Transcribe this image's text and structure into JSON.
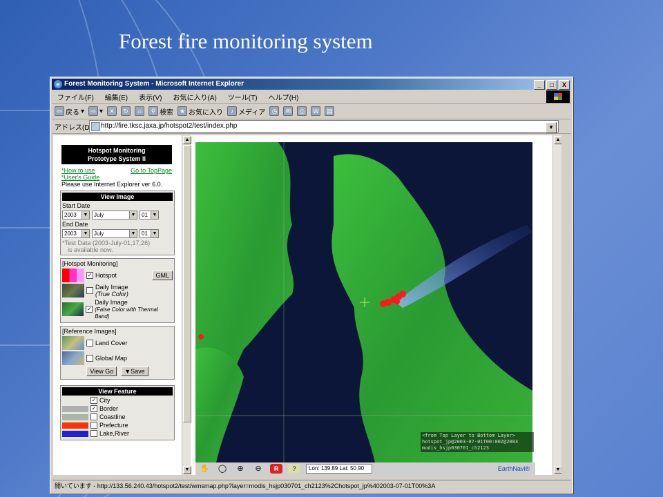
{
  "slide": {
    "title": "Forest fire monitoring system"
  },
  "window": {
    "title": "Forest Monitoring System - Microsoft Internet Explorer",
    "controls": [
      "_",
      "□",
      "X"
    ]
  },
  "menu": [
    "ファイル(F)",
    "編集(E)",
    "表示(V)",
    "お気に入り(A)",
    "ツール(T)",
    "ヘルプ(H)"
  ],
  "toolbar": {
    "back": "戻る",
    "search": "検索",
    "favorites": "お気に入り",
    "media": "メディア"
  },
  "address": {
    "label": "アドレス(D)",
    "url": "http://fire.tksc.jaxa.jp/hotspot2/test/index.php"
  },
  "panel": {
    "title_line1": "Hotspot Monitoring",
    "title_line2": "Prototype System II",
    "how_to_use": "*How to use",
    "go_top": "Go to TopPage",
    "users_guide": "*User's Guide",
    "ie_note": "Please use Internet Explorer ver 6.0.",
    "view_image": "View Image",
    "start_date": "Start Date",
    "end_date": "End Date",
    "start": {
      "year": "2003",
      "month": "July",
      "day": "01"
    },
    "end": {
      "year": "2003",
      "month": "July",
      "day": "01"
    },
    "test_data": "*Test Data (2003-July-01,17,26)",
    "test_data2": "is available now.",
    "hotspot_head": "[Hotspot Monitoring]",
    "hotspot": "Hotspot",
    "gml": "GML",
    "daily_true": "Daily Image",
    "daily_true_sub": "(True Color)",
    "daily_false": "Daily Image",
    "daily_false_sub": "(False Color with Thermal Band)",
    "ref_head": "[Reference Images]",
    "land_cover": "Land Cover",
    "global_map": "Global Map",
    "view_go": "View Go",
    "save": "▼Save",
    "view_feature": "View Feature",
    "features": [
      {
        "label": "City",
        "checked": true,
        "color": ""
      },
      {
        "label": "Border",
        "checked": true,
        "color": "#b0b0b0"
      },
      {
        "label": "Coastline",
        "checked": false,
        "color": "#a8b8a8"
      },
      {
        "label": "Prefecture",
        "checked": false,
        "color": "#ff3300"
      },
      {
        "label": "Lake,River",
        "checked": false,
        "color": "#2222cc"
      }
    ]
  },
  "map": {
    "layer_note": "<from Top Layer to Bottom Layer>",
    "layer_1": "hotspot_jp@2003-07-01T00:00Z@2003",
    "layer_2": "modis_hsjp030701_ch2123",
    "lon_label": "Lon:",
    "lon": "139.89",
    "lat_label": "Lat:",
    "lat": "50.90",
    "earthnavi": "EarthNavi®"
  },
  "status": {
    "text": "開いています - http://133.56.240.43/hotspot2/test/wmsmap.php?layer=modis_hsjp030701_ch2123%2Chotspot_jp%402003-07-01T00%3A"
  }
}
